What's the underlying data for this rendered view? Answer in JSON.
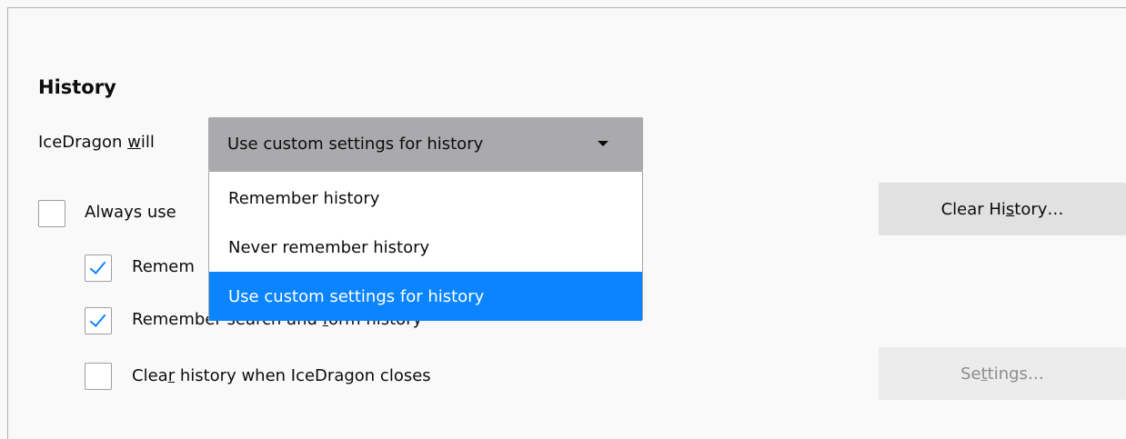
{
  "section": {
    "title": "History"
  },
  "history_mode": {
    "label_pre": "IceDragon ",
    "label_access": "w",
    "label_post": "ill",
    "selected": "Use custom settings for history",
    "options": [
      "Remember history",
      "Never remember history",
      "Use custom settings for history"
    ]
  },
  "checkboxes": [
    {
      "text": "Always use",
      "checked": false
    },
    {
      "text": "Remem",
      "checked": true
    },
    {
      "text_pre": "Remember search and ",
      "text_access": "f",
      "text_post": "orm history",
      "checked": true
    },
    {
      "text_pre": "Clea",
      "text_access": "r",
      "text_post": " history when IceDragon closes",
      "checked": false
    }
  ],
  "buttons": {
    "clear_history_pre": "Clear Hi",
    "clear_history_access": "s",
    "clear_history_post": "tory…",
    "settings_pre": "Se",
    "settings_access": "t",
    "settings_post": "tings…"
  }
}
